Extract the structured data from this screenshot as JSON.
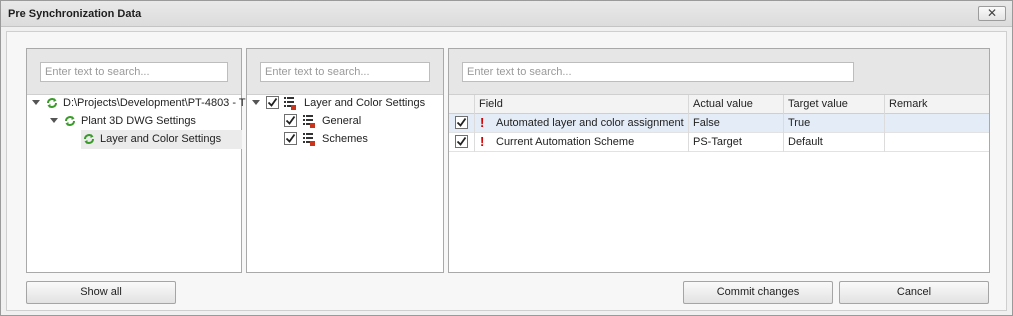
{
  "window": {
    "title": "Pre Synchronization Data",
    "close_glyph": "✕"
  },
  "left_panel": {
    "search_placeholder": "Enter text to search...",
    "tree": [
      {
        "label": "D:\\Projects\\Development\\PT-4803 - T",
        "icon": "sync-icon",
        "expanded": true,
        "level": 0
      },
      {
        "label": "Plant 3D DWG Settings",
        "icon": "sync-icon",
        "expanded": true,
        "level": 1
      },
      {
        "label": "Layer and Color Settings",
        "icon": "sync-icon",
        "expanded": false,
        "level": 2,
        "selected": true
      }
    ]
  },
  "middle_panel": {
    "search_placeholder": "Enter text to search...",
    "tree": [
      {
        "label": "Layer and Color Settings",
        "checked": true,
        "icon": "list-icon",
        "expanded": true,
        "level": 0
      },
      {
        "label": "General",
        "checked": true,
        "icon": "list-icon",
        "level": 1
      },
      {
        "label": "Schemes",
        "checked": true,
        "icon": "list-icon",
        "level": 1
      }
    ]
  },
  "right_panel": {
    "search_placeholder": "Enter text to search...",
    "columns": [
      "Field",
      "Actual value",
      "Target value",
      "Remark"
    ],
    "rows": [
      {
        "checked": true,
        "flag": "!",
        "field": "Automated layer and color assignment",
        "actual": "False",
        "target": "True",
        "remark": ""
      },
      {
        "checked": true,
        "flag": "!",
        "field": "Current Automation Scheme",
        "actual": "PS-Target",
        "target": "Default",
        "remark": ""
      }
    ]
  },
  "buttons": {
    "show_all": "Show all",
    "commit": "Commit changes",
    "cancel": "Cancel"
  },
  "colors": {
    "sync_icon": "#3a9a2a",
    "list_icon_red": "#c8341c",
    "flag": "#d20000",
    "selected_row": "#e4ecf7"
  }
}
